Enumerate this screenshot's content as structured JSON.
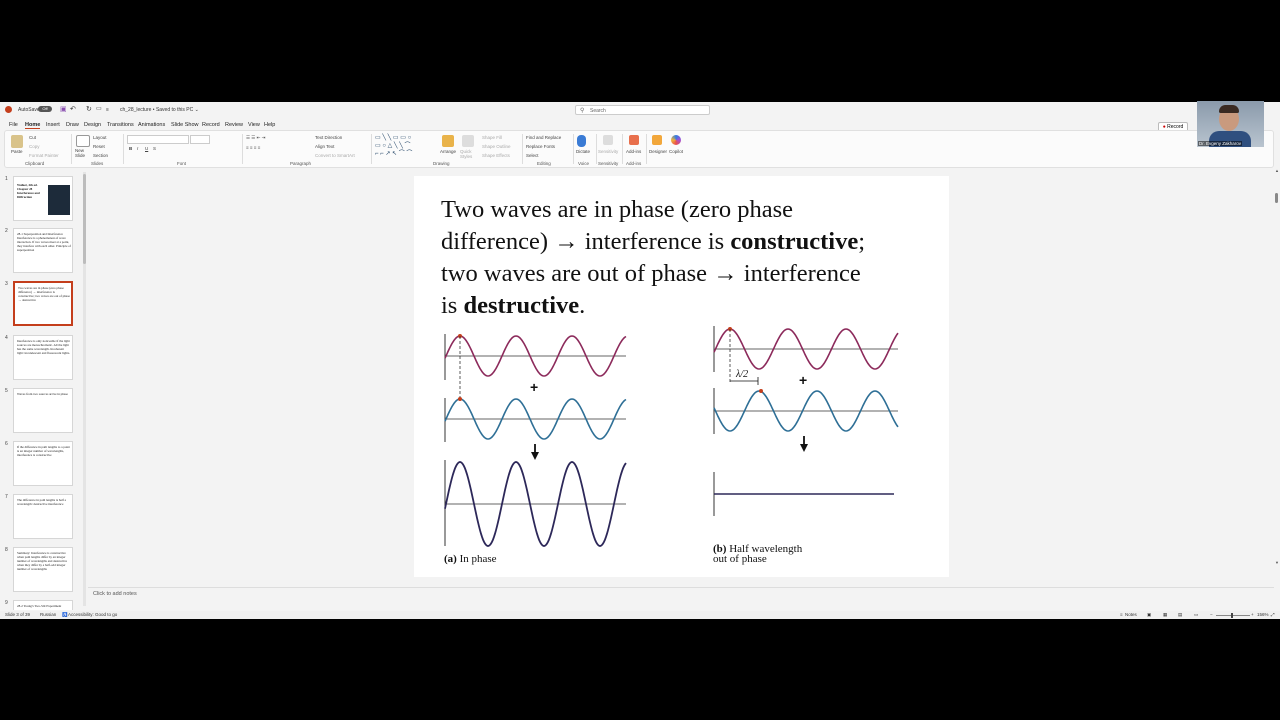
{
  "titlebar": {
    "autosave": "AutoSave",
    "toggle": "Off",
    "doc_title": "ch_28_lecture • Saved to this PC ⌄",
    "search_placeholder": "Search",
    "record": "Record"
  },
  "menu": {
    "items": [
      "File",
      "Home",
      "Insert",
      "Draw",
      "Design",
      "Transitions",
      "Animations",
      "Slide Show",
      "Record",
      "Review",
      "View",
      "Help"
    ]
  },
  "ribbon": {
    "paste": "Paste",
    "cut": "Cut",
    "copy": "Copy",
    "format_painter": "Format Painter",
    "clipboard": "Clipboard",
    "new_slide": "New Slide",
    "layout": "Layout",
    "reset": "Reset",
    "section": "Section",
    "slides": "Slides",
    "font": "Font",
    "text_direction": "Text Direction",
    "align_text": "Align Text",
    "convert_smartart": "Convert to SmartArt",
    "paragraph": "Paragraph",
    "arrange": "Arrange",
    "quick_styles": "Quick Styles",
    "shape_fill": "Shape Fill",
    "shape_outline": "Shape Outline",
    "shape_effects": "Shape Effects",
    "drawing": "Drawing",
    "find_replace": "Find and Replace",
    "replace_fonts": "Replace Fonts",
    "select": "Select",
    "editing": "Editing",
    "dictate": "Dictate",
    "voice": "Voice",
    "sensitivity": "Sensitivity",
    "sensitivity_group": "Sensitivity",
    "addins": "Add-ins",
    "addins_group": "Add-ins",
    "designer": "Designer",
    "copilot": "Copilot"
  },
  "webcam": {
    "name": "Dr. Evgeny Zakharov"
  },
  "thumbnails": [
    {
      "num": "1",
      "text": "Walker, 4th ed. Chapter 28 Interference and Diffraction"
    },
    {
      "num": "2",
      "text": "28-1 Superposition and Interference Interference is a phenomenon of wave interaction. If two waves meet at a point, they interfere with each other. Principle of superposition"
    },
    {
      "num": "3",
      "text": "Two waves are in phase (zero phase difference) → interference is constructive; two waves are out of phase → destructive"
    },
    {
      "num": "4",
      "text": "Interference is only noticeable if the light sources are monochromatic. All the light has the same wavelength. Incoherent light: incandescent and fluorescent lights."
    },
    {
      "num": "5",
      "text": "Waves from two sources arrive in phase"
    },
    {
      "num": "6",
      "text": "If the difference in path lengths to a point is an integer number of wavelengths, interference is constructive"
    },
    {
      "num": "7",
      "text": "The difference in path lengths is half a wavelength: destructive interference"
    },
    {
      "num": "8",
      "text": "Summary: Interference is constructive when path lengths differ by an integer number of wavelengths and destructive when they differ by a half-odd integer number of wavelengths"
    },
    {
      "num": "9",
      "text": "28-2 Young's Two-Slit Experiment"
    }
  ],
  "slide": {
    "line1": "Two waves are in phase (zero phase",
    "line2a": "difference) → interference is ",
    "line2b": "constructive",
    "line2c": ";",
    "line3": "two waves are out of phase → interference",
    "line4a": "is ",
    "line4b": "destructive",
    "line4c": ".",
    "plus": "+",
    "lambda_label": "λ/2",
    "caption_a_tag": "(a)",
    "caption_a": " In phase",
    "caption_b_tag": "(b)",
    "caption_b_line1": " Half wavelength",
    "caption_b_line2": "out of phase"
  },
  "notes": {
    "placeholder": "Click to add notes"
  },
  "status": {
    "slide_info": "Slide 3 of 39",
    "language": "Russian",
    "accessibility": "Accessibility: Good to go",
    "notes_btn": "Notes",
    "zoom": "156%"
  },
  "colors": {
    "wave_a": "#8c2a5b",
    "wave_b": "#2e6f96",
    "wave_sum": "#2d2859",
    "accent": "#c43e1c"
  }
}
